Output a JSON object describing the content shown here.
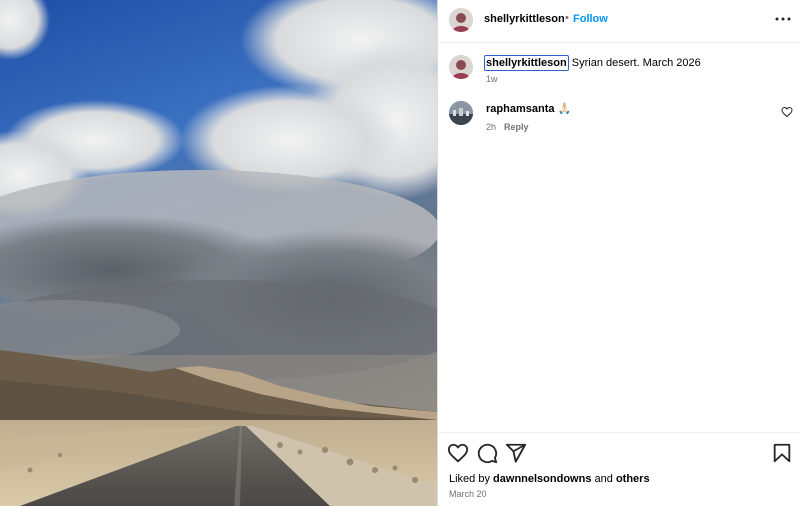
{
  "post": {
    "author": "shellyrkittleson",
    "separator": "•",
    "follow_label": "Follow",
    "caption_user": "shellyrkittleson",
    "caption_text": "Syrian desert. March 2026",
    "caption_time": "1w",
    "image_alt": "Desert road under cloudy sky",
    "liked_prefix": "Liked by",
    "liked_user": "dawnnelsondowns",
    "liked_and": "and",
    "liked_others": "others",
    "date": "March 20"
  },
  "comments": [
    {
      "user": "raphamsanta",
      "text": "🙏🏻",
      "time": "2h",
      "reply_label": "Reply"
    }
  ],
  "icons": {
    "more": "more-horizontal-icon",
    "like": "heart-icon",
    "comment": "comment-icon",
    "share": "share-icon",
    "save": "bookmark-icon"
  },
  "colors": {
    "follow": "#0095f6",
    "muted": "#737373",
    "border": "#dbdbdb"
  }
}
